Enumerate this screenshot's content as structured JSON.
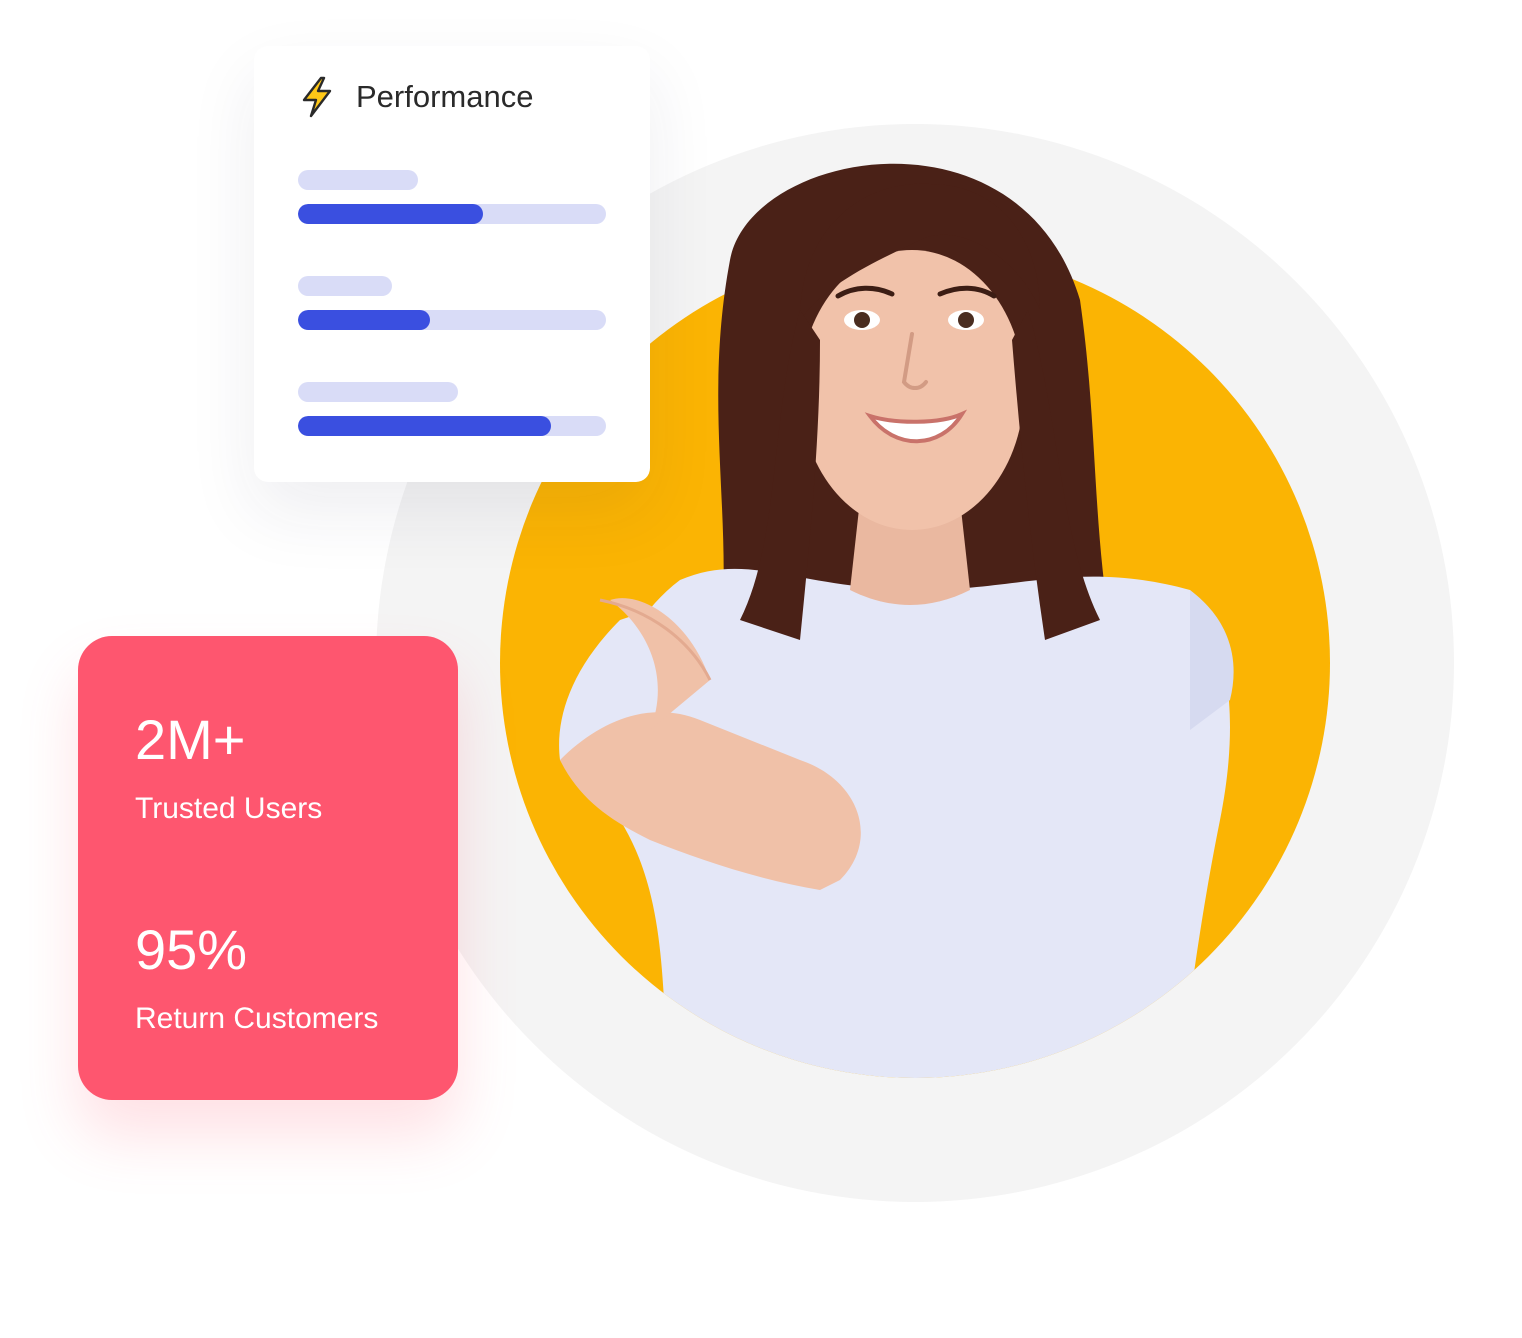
{
  "colors": {
    "accent_circle": "#fbb403",
    "background_circle": "#f4f4f4",
    "stats_card": "#fe566f",
    "progress_fill": "#3a4fe0",
    "progress_track": "#d9dcf7"
  },
  "performance_card": {
    "icon": "lightning-bolt-icon",
    "title": "Performance",
    "metrics": [
      {
        "progress": 0.6
      },
      {
        "progress": 0.43
      },
      {
        "progress": 0.82
      }
    ]
  },
  "stats_card": {
    "stats": [
      {
        "value": "2M+",
        "label": "Trusted Users"
      },
      {
        "value": "95%",
        "label": "Return Customers"
      }
    ]
  }
}
